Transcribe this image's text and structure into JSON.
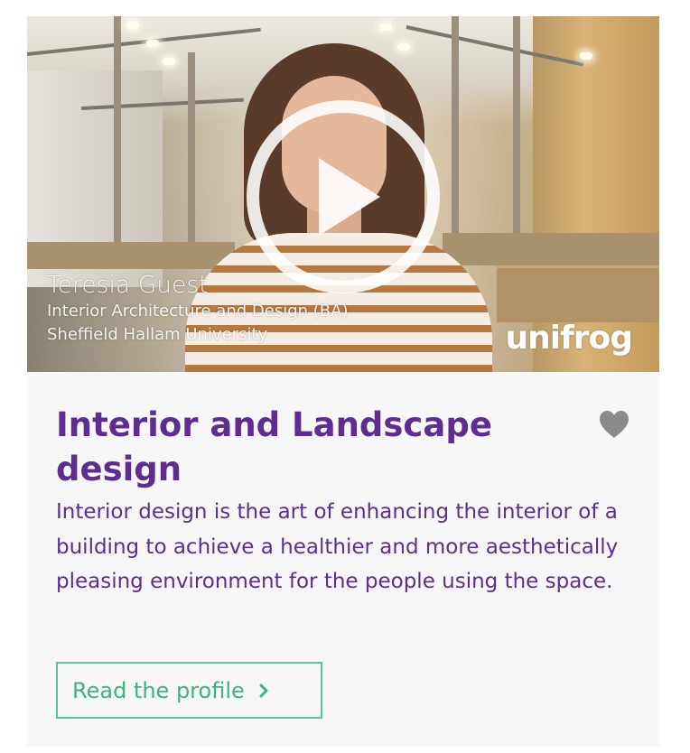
{
  "video": {
    "presenter_name": "Teresia Guest",
    "presenter_course": "Interior Architecture and Design (BA)",
    "presenter_university": "Sheffield Hallam University",
    "brand": "unifrog",
    "play_icon": "play-circle-icon"
  },
  "profile": {
    "title": "Interior and Landscape design",
    "description": "Interior design is the art of enhancing the interior of a building to achieve a healthier and more aesthetically pleasing environment for the people using the space.",
    "favourite_icon": "heart-icon",
    "read_button_label": "Read the profile",
    "read_button_icon": "chevron-right-icon"
  },
  "colors": {
    "title_purple": "#5e2d91",
    "button_green": "#3fb27f",
    "card_background": "#f7f7f7",
    "heart_grey": "#8a8a8a"
  }
}
